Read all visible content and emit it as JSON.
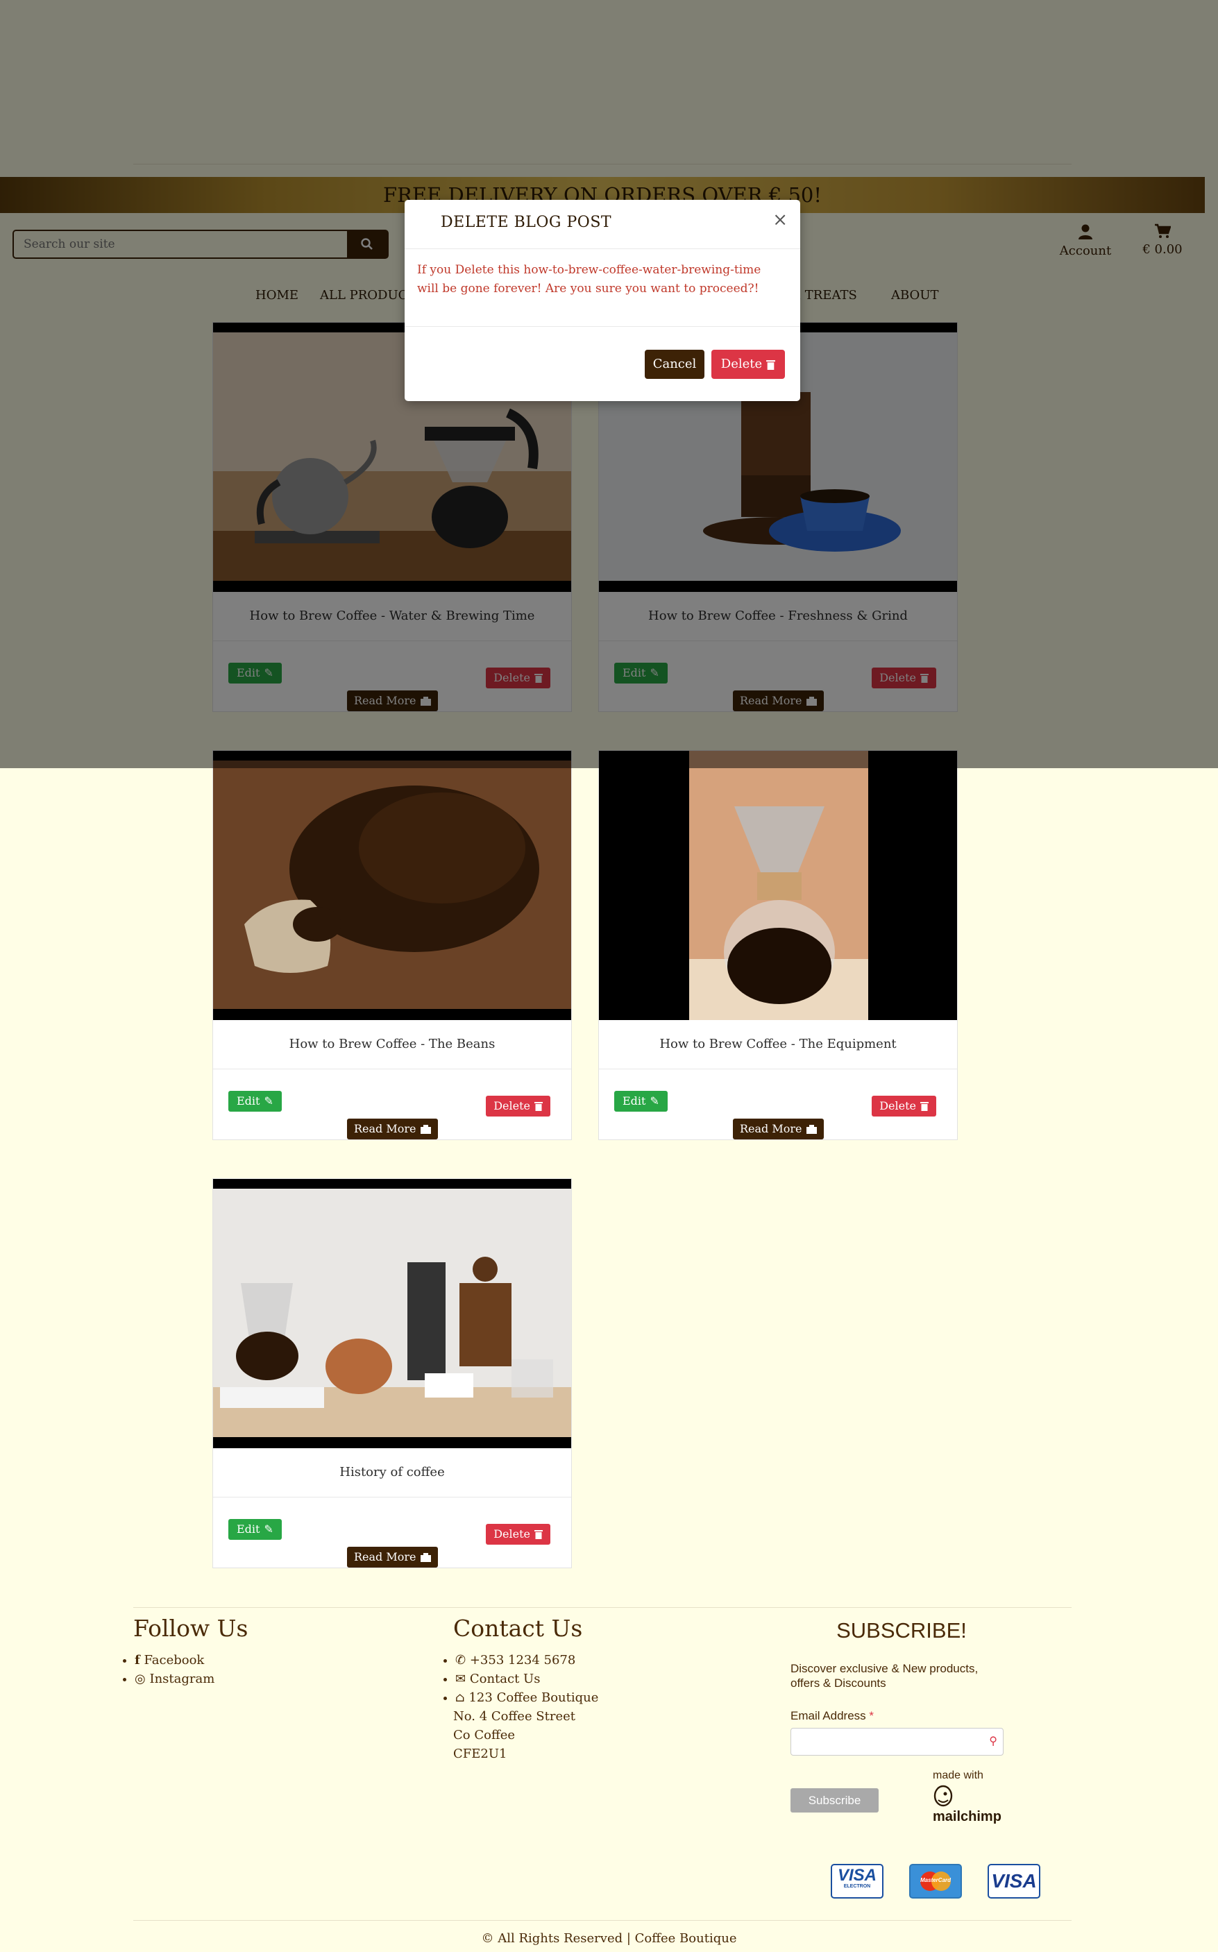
{
  "banner": {
    "text": "FREE DELIVERY ON ORDERS OVER € 50!"
  },
  "search": {
    "placeholder": "Search our site"
  },
  "header": {
    "account_label": "Account",
    "cart_total": "€ 0.00"
  },
  "nav": {
    "items": [
      "HOME",
      "ALL PRODUCTS",
      "& TREATS",
      "ABOUT"
    ]
  },
  "posts": [
    {
      "title": "How to Brew Coffee - Water & Brewing Time",
      "edit": "Edit",
      "delete": "Delete",
      "read_more": "Read More"
    },
    {
      "title": "How to Brew Coffee - Freshness & Grind",
      "edit": "Edit",
      "delete": "Delete",
      "read_more": "Read More"
    },
    {
      "title": "How to Brew Coffee - The Beans",
      "edit": "Edit",
      "delete": "Delete",
      "read_more": "Read More"
    },
    {
      "title": "How to Brew Coffee - The Equipment",
      "edit": "Edit",
      "delete": "Delete",
      "read_more": "Read More"
    },
    {
      "title": "History of coffee",
      "edit": "Edit",
      "delete": "Delete",
      "read_more": "Read More"
    }
  ],
  "modal": {
    "title": "DELETE BLOG POST",
    "close": "×",
    "message_line1": "If you Delete this how-to-brew-coffee-water-brewing-time",
    "message_line2": "will be gone forever! Are you sure you want to proceed?!",
    "cancel_label": "Cancel",
    "delete_label": "Delete"
  },
  "footer": {
    "follow": {
      "heading": "Follow Us",
      "links": [
        "Facebook",
        "Instagram"
      ]
    },
    "contact": {
      "heading": "Contact Us",
      "phone": "+353 1234 5678",
      "email_link": "Contact Us",
      "address": [
        "123 Coffee Boutique",
        "No. 4 Coffee Street",
        "Co Coffee",
        "CFE2U1"
      ]
    },
    "subscribe": {
      "heading": "SUBSCRIBE!",
      "text_line1": "Discover exclusive & New products,",
      "text_line2": "offers & Discounts",
      "email_label": "Email Address",
      "required_mark": "*",
      "button": "Subscribe",
      "made_with": "made with",
      "brand": "mailchimp"
    },
    "payment_cards": [
      "VISA",
      "MasterCard",
      "VISA"
    ],
    "payment_sub": "ELECTRON",
    "copyright": "All Rights Reserved | Coffee Boutique"
  },
  "colors": {
    "background": "#fffee6",
    "brand_brown": "#3d2206",
    "edit_green": "#28a745",
    "delete_red": "#dc3545",
    "overlay": "rgba(0,0,0,0.5)"
  }
}
